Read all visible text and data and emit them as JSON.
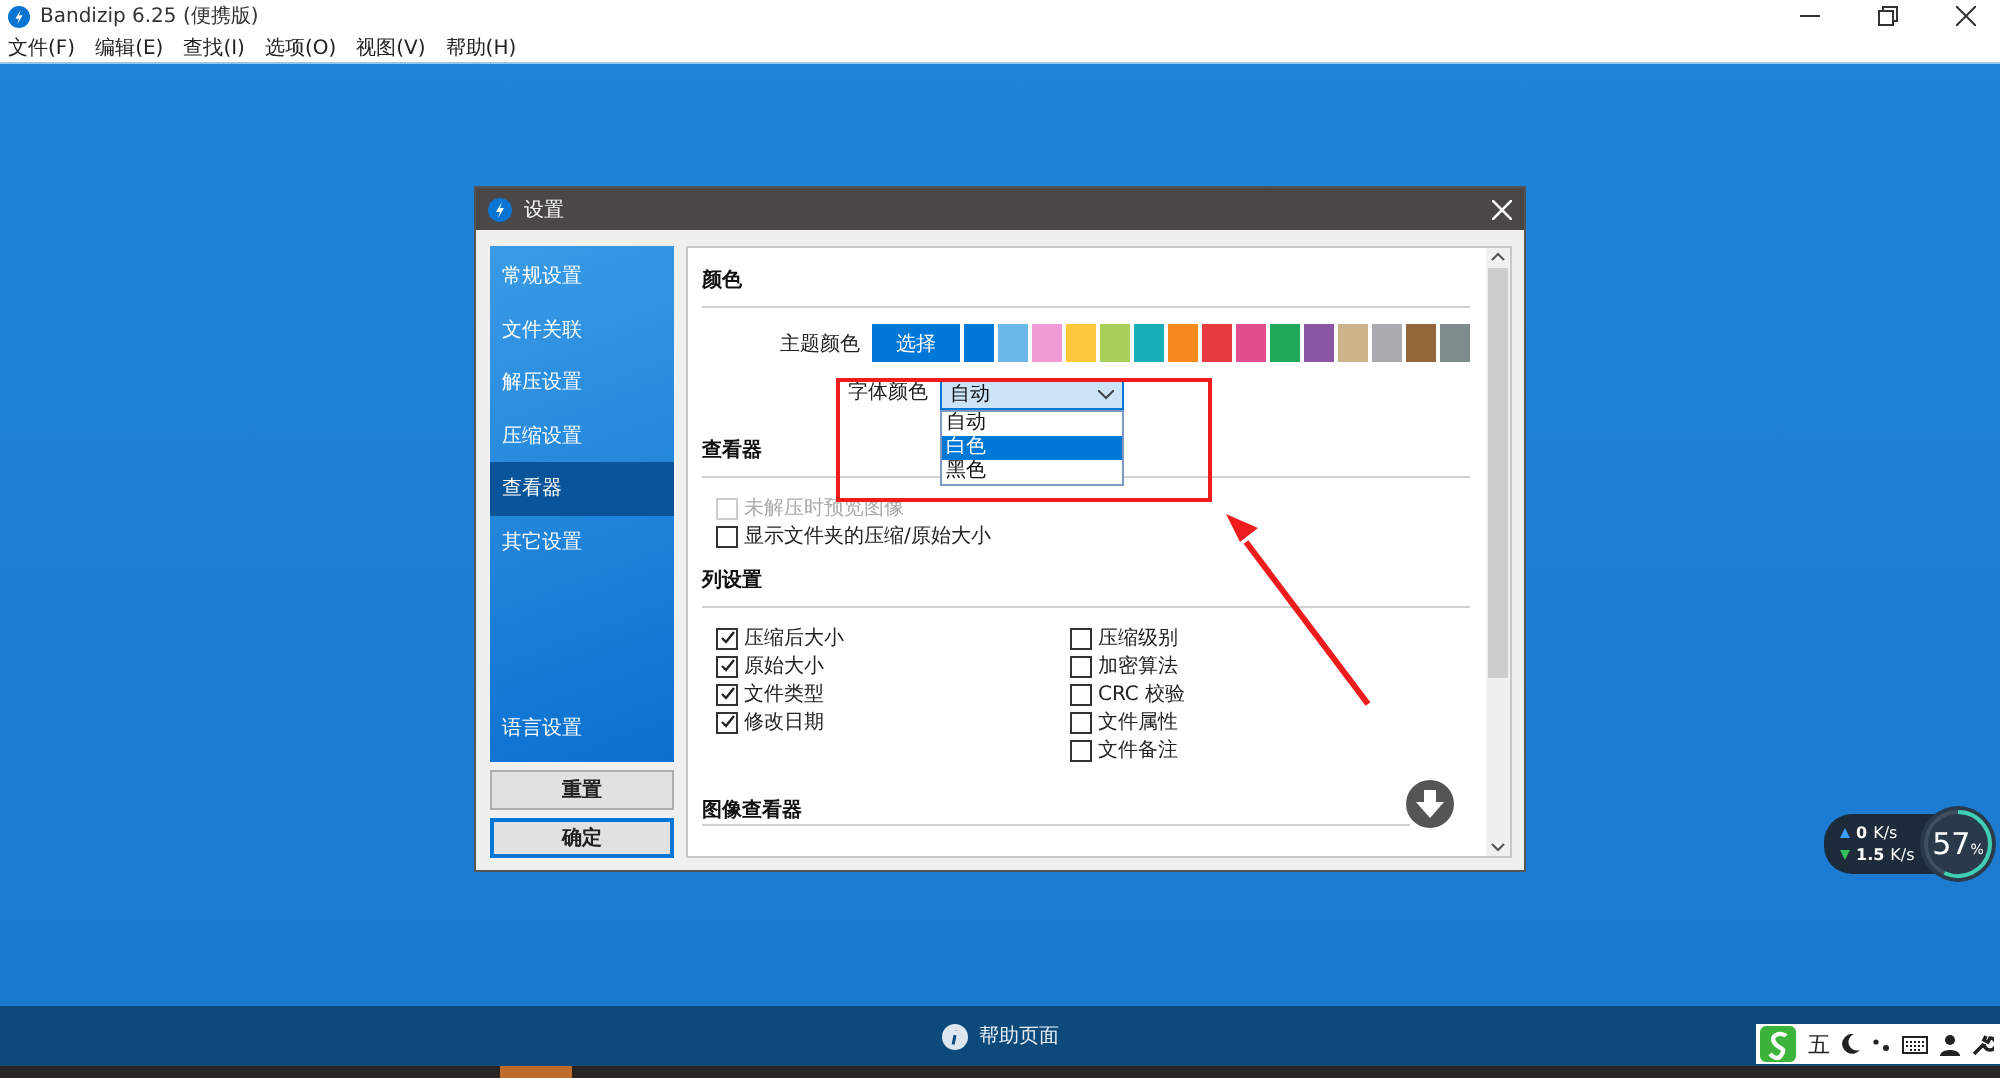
{
  "window": {
    "title": "Bandizip 6.25 (便携版)"
  },
  "menu": [
    "文件(F)",
    "编辑(E)",
    "查找(I)",
    "选项(O)",
    "视图(V)",
    "帮助(H)"
  ],
  "dialog": {
    "title": "设置",
    "sidebar": [
      {
        "label": "常规设置",
        "selected": false
      },
      {
        "label": "文件关联",
        "selected": false
      },
      {
        "label": "解压设置",
        "selected": false
      },
      {
        "label": "压缩设置",
        "selected": false
      },
      {
        "label": "查看器",
        "selected": true
      },
      {
        "label": "其它设置",
        "selected": false
      }
    ],
    "language_item": {
      "label": "语言设置",
      "selected": false
    },
    "buttons": [
      {
        "label": "重置",
        "default": false
      },
      {
        "label": "确定",
        "default": true
      }
    ],
    "color_section": {
      "heading": "颜色",
      "theme_label": "主题颜色",
      "choose_button": "选择",
      "swatches": [
        {
          "color": "#0078d7"
        },
        {
          "color": "#6cb8ea"
        },
        {
          "color": "#f29ad4"
        },
        {
          "color": "#fdc93a"
        },
        {
          "color": "#a8d05a"
        },
        {
          "color": "#1aaeb8"
        },
        {
          "color": "#f7891f"
        },
        {
          "color": "#e63b3e"
        },
        {
          "color": "#e24d8f"
        },
        {
          "color": "#21a95b"
        },
        {
          "color": "#8a56a4"
        },
        {
          "color": "#cdb38a"
        },
        {
          "color": "#a9abae"
        },
        {
          "color": "#94673a"
        },
        {
          "color": "#7f8c8d"
        }
      ],
      "font_label": "字体颜色",
      "font_select": {
        "value": "自动",
        "expanded": true,
        "options": [
          {
            "label": "自动",
            "highlighted": false
          },
          {
            "label": "白色",
            "highlighted": true
          },
          {
            "label": "黑色",
            "highlighted": false
          }
        ]
      }
    },
    "viewer_section": {
      "heading": "查看器",
      "options": [
        {
          "label": "未解压时预览图像",
          "checked": false,
          "disabled": true
        },
        {
          "label": "显示文件夹的压缩/原始大小",
          "checked": false,
          "disabled": false
        }
      ]
    },
    "columns_section": {
      "heading": "列设置",
      "left": [
        {
          "label": "压缩后大小",
          "checked": true
        },
        {
          "label": "原始大小",
          "checked": true
        },
        {
          "label": "文件类型",
          "checked": true
        },
        {
          "label": "修改日期",
          "checked": true
        }
      ],
      "right": [
        {
          "label": "压缩级别",
          "checked": false
        },
        {
          "label": "加密算法",
          "checked": false
        },
        {
          "label": "CRC 校验",
          "checked": false
        },
        {
          "label": "文件属性",
          "checked": false
        },
        {
          "label": "文件备注",
          "checked": false
        }
      ]
    },
    "image_viewer_section": {
      "heading": "图像查看器"
    }
  },
  "net_widget": {
    "upload": "0",
    "upload_unit": "K/s",
    "download": "1.5",
    "download_unit": "K/s",
    "cpu": "57",
    "cpu_unit": "%",
    "level": 0.57
  },
  "ime_bar": {
    "mode": "五"
  },
  "help_bar": {
    "label": "帮助页面"
  }
}
